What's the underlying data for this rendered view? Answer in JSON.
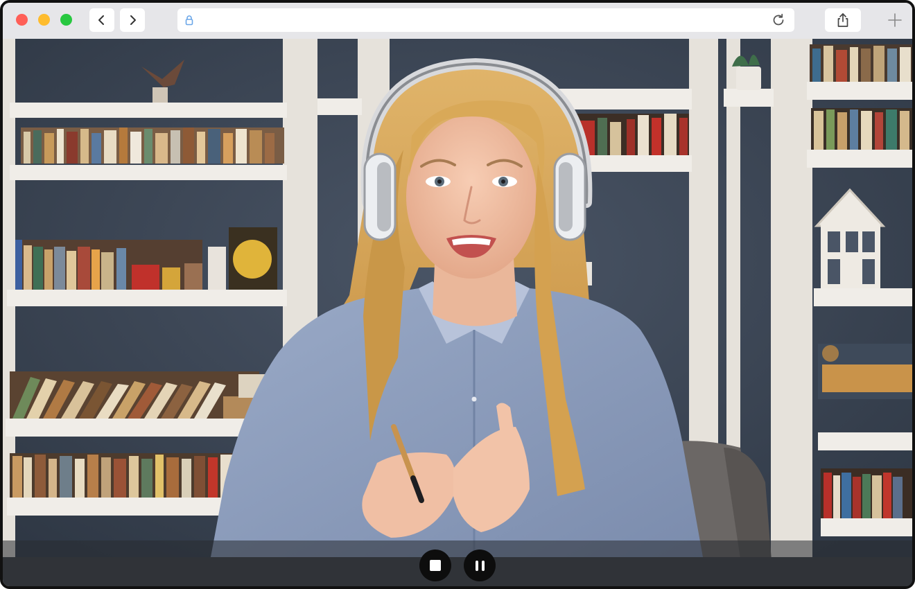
{
  "browser": {
    "address_value": "",
    "icons": {
      "back": "chevron-left-icon",
      "forward": "chevron-right-icon",
      "lock": "lock-icon",
      "reload": "reload-icon",
      "share": "share-icon",
      "new_tab": "plus-icon"
    }
  },
  "video": {
    "subject": "woman-with-headphones-video-call",
    "controls": [
      {
        "name": "stop",
        "icon": "stop-icon"
      },
      {
        "name": "pause",
        "icon": "pause-icon"
      }
    ]
  },
  "colors": {
    "close": "#ff5f57",
    "minimize": "#febc2e",
    "zoom": "#28c840",
    "control_button": "#0d0d0d"
  }
}
